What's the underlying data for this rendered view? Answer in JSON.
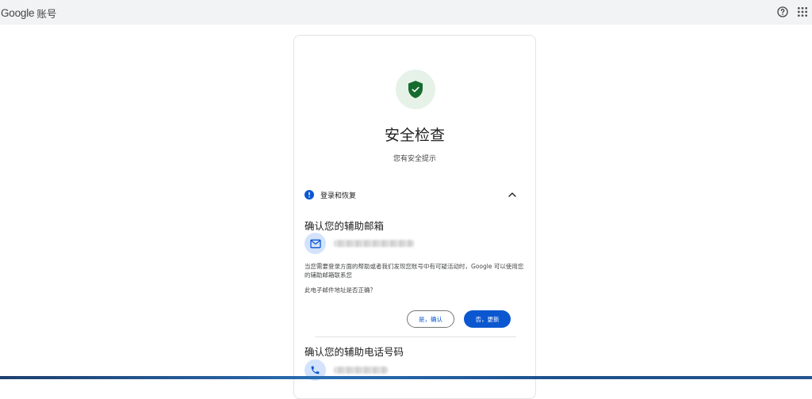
{
  "header": {
    "brand_google": "Google",
    "brand_product": "账号",
    "help_icon": "help-circle-icon",
    "apps_icon": "apps-grid-icon"
  },
  "card": {
    "icon": "shield-check-icon",
    "title": "安全检查",
    "subtitle": "您有安全提示",
    "section": {
      "icon": "alert-circle-icon",
      "label": "登录和恢复",
      "expanded": true,
      "toggle_icon": "chevron-up-icon"
    },
    "email_item": {
      "title": "确认您的辅助邮箱",
      "icon": "mail-icon",
      "description": "当您需要登录方面的帮助或者我们发现您账号中有可疑活动时，Google 可以使用您的辅助邮箱联系您",
      "question": "此电子邮件地址是否正确？",
      "confirm_label": "是，确认",
      "update_label": "否，更新"
    },
    "phone_item": {
      "title": "确认您的辅助电话号码",
      "icon": "phone-icon"
    }
  },
  "colors": {
    "accent": "#0b57d0",
    "shield_green": "#146c2e",
    "shield_bg": "#e6f2e8",
    "avatar_bg": "#d3e3fd",
    "topbar_bg": "#f1f3f4"
  }
}
